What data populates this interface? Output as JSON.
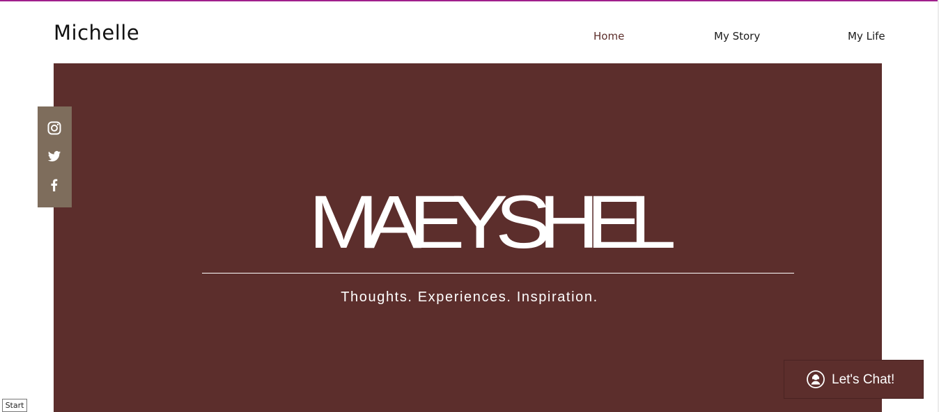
{
  "header": {
    "site_title": "Michelle",
    "nav": [
      {
        "label": "Home",
        "active": true
      },
      {
        "label": "My Story",
        "active": false
      },
      {
        "label": "My Life",
        "active": false
      }
    ]
  },
  "hero": {
    "brand": "MAEYSHEL",
    "tagline": "Thoughts. Experiences. Inspiration.",
    "background_color": "#5c2e2c"
  },
  "social": {
    "icons": [
      "instagram-icon",
      "twitter-icon",
      "facebook-icon"
    ],
    "bar_color": "#7e6d5c"
  },
  "chat": {
    "label": "Let's Chat!",
    "icon": "chat-person-icon"
  },
  "corner_label": "Start",
  "colors": {
    "accent_line": "#a0208c",
    "nav_active": "#5c2e2b"
  }
}
